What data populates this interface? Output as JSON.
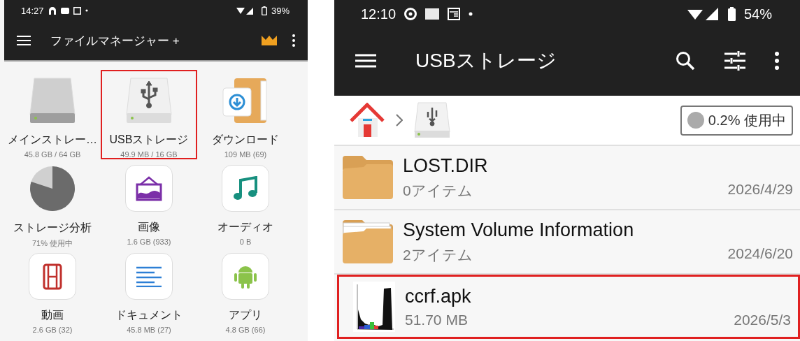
{
  "left_phone": {
    "status_bar": {
      "time": "14:27",
      "battery": "39%"
    },
    "app_bar": {
      "title": "ファイルマネージャー +"
    },
    "tiles": [
      {
        "kind": "drive",
        "label": "メインストレー…",
        "detail": "45.8 GB / 64 GB",
        "highlighted": false
      },
      {
        "kind": "usb-drive",
        "label": "USBストレージ",
        "detail": "49.9 MB / 16 GB",
        "highlighted": true
      },
      {
        "kind": "downloads",
        "label": "ダウンロード",
        "detail": "109 MB (69)",
        "highlighted": false
      },
      {
        "kind": "pie",
        "label": "ストレージ分析",
        "detail": "71% 使用中",
        "highlighted": false
      },
      {
        "kind": "images",
        "label": "画像",
        "detail": "1.6 GB (933)",
        "highlighted": false
      },
      {
        "kind": "audio",
        "label": "オーディオ",
        "detail": "0 B",
        "highlighted": false
      },
      {
        "kind": "video",
        "label": "動画",
        "detail": "2.6 GB (32)",
        "highlighted": false
      },
      {
        "kind": "documents",
        "label": "ドキュメント",
        "detail": "45.8 MB (27)",
        "highlighted": false
      },
      {
        "kind": "apps",
        "label": "アプリ",
        "detail": "4.8 GB (66)",
        "highlighted": false
      }
    ]
  },
  "right_phone": {
    "status_bar": {
      "time": "12:10",
      "battery": "54%"
    },
    "app_bar": {
      "title": "USBストレージ"
    },
    "usage_badge": "0.2% 使用中",
    "files": [
      {
        "kind": "folder",
        "name": "LOST.DIR",
        "detail": "0アイテム",
        "date": "2026/4/29",
        "highlighted": false
      },
      {
        "kind": "folder-files",
        "name": "System Volume Information",
        "detail": "2アイテム",
        "date": "2024/6/20",
        "highlighted": false
      },
      {
        "kind": "thumbnail",
        "name": "ccrf.apk",
        "detail": "51.70 MB",
        "date": "2026/5/3",
        "highlighted": true
      }
    ]
  }
}
